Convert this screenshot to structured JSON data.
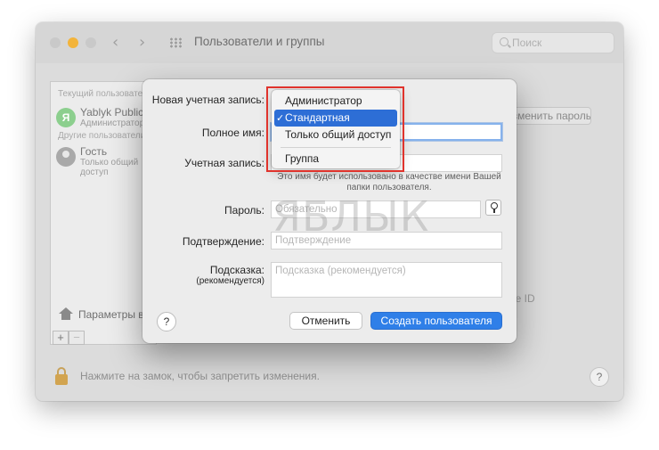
{
  "window": {
    "title": "Пользователи и группы",
    "search_placeholder": "Поиск",
    "nav_back": "‹",
    "nav_forward": "›"
  },
  "user_list": {
    "current_section": "Текущий пользователь",
    "current_user": {
      "name": "Yablyk Public",
      "role": "Администратор",
      "initial": "Я"
    },
    "other_section": "Другие пользователи",
    "other_user": {
      "name": "Гость",
      "role": "Только общий доступ"
    },
    "login_options": "Параметры входа",
    "add_label": "+",
    "remove_label": "−"
  },
  "background": {
    "change_password_button": "Изменить пароль...",
    "apple_id_fragment": "le ID",
    "lock_text": "Нажмите на замок, чтобы запретить изменения.",
    "help": "?"
  },
  "sheet": {
    "account_type_label": "Новая учетная запись:",
    "full_name_label": "Полное имя:",
    "account_name_label": "Учетная запись:",
    "account_hint": "Это имя будет использовано в качестве имени Вашей папки пользователя.",
    "password_label": "Пароль:",
    "password_placeholder": "Обязательно",
    "verify_label": "Подтверждение:",
    "verify_placeholder": "Подтверждение",
    "hint_label": "Подсказка:",
    "hint_label_sub": "(рекомендуется)",
    "hint_placeholder": "Подсказка (рекомендуется)",
    "help": "?",
    "cancel_button": "Отменить",
    "create_button": "Создать пользователя",
    "watermark": "ЯБЛЫК"
  },
  "account_type_menu": {
    "items": [
      {
        "label": "Администратор",
        "selected": false
      },
      {
        "label": "Стандартная",
        "selected": true
      },
      {
        "label": "Только общий доступ",
        "selected": false
      },
      {
        "label": "Группа",
        "selected": false
      }
    ],
    "check_mark": "✓"
  },
  "colors": {
    "accent": "#2f7fe8",
    "menu_selection": "#2d6ed6",
    "annotation_red": "#e0332c",
    "traffic_min": "#f3b43b"
  }
}
